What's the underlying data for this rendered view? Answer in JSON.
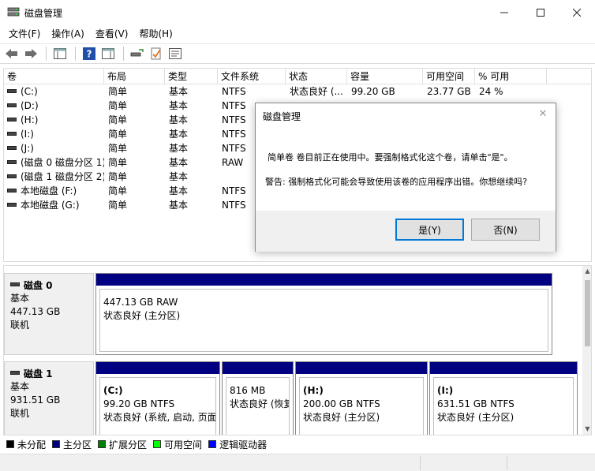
{
  "window": {
    "title": "磁盘管理",
    "minimize": "—",
    "maximize": "☐",
    "close": "✕"
  },
  "menu": [
    {
      "label": "文件(F)"
    },
    {
      "label": "操作(A)"
    },
    {
      "label": "查看(V)"
    },
    {
      "label": "帮助(H)"
    }
  ],
  "toolbar": {
    "icons": [
      "back-arrow-icon",
      "forward-arrow-icon",
      "console-tree-icon",
      "help-icon",
      "action-pane-icon",
      "connect-icon",
      "checklist-icon",
      "properties-icon"
    ]
  },
  "volume_list": {
    "columns": [
      "卷",
      "布局",
      "类型",
      "文件系统",
      "状态",
      "容量",
      "可用空间",
      "% 可用"
    ],
    "rows": [
      {
        "volume": "(C:)",
        "layout": "简单",
        "type": "基本",
        "fs": "NTFS",
        "status": "状态良好 (...",
        "capacity": "99.20 GB",
        "free": "23.77 GB",
        "pct": "24 %"
      },
      {
        "volume": "(D:)",
        "layout": "简单",
        "type": "基本",
        "fs": "NTFS",
        "status": "",
        "capacity": "",
        "free": "",
        "pct": ""
      },
      {
        "volume": "(H:)",
        "layout": "简单",
        "type": "基本",
        "fs": "NTFS",
        "status": "",
        "capacity": "",
        "free": "",
        "pct": ""
      },
      {
        "volume": "(I:)",
        "layout": "简单",
        "type": "基本",
        "fs": "NTFS",
        "status": "",
        "capacity": "",
        "free": "",
        "pct": ""
      },
      {
        "volume": "(J:)",
        "layout": "简单",
        "type": "基本",
        "fs": "NTFS",
        "status": "",
        "capacity": "",
        "free": "",
        "pct": ""
      },
      {
        "volume": "(磁盘 0 磁盘分区 1)",
        "layout": "简单",
        "type": "基本",
        "fs": "RAW",
        "status": "",
        "capacity": "",
        "free": "",
        "pct": ""
      },
      {
        "volume": "(磁盘 1 磁盘分区 2)",
        "layout": "简单",
        "type": "基本",
        "fs": "",
        "status": "",
        "capacity": "",
        "free": "",
        "pct": ""
      },
      {
        "volume": "本地磁盘 (F:)",
        "layout": "简单",
        "type": "基本",
        "fs": "NTFS",
        "status": "",
        "capacity": "",
        "free": "",
        "pct": ""
      },
      {
        "volume": "本地磁盘 (G:)",
        "layout": "简单",
        "type": "基本",
        "fs": "NTFS",
        "status": "",
        "capacity": "",
        "free": "",
        "pct": ""
      }
    ]
  },
  "disks": [
    {
      "name": "磁盘 0",
      "kind": "基本",
      "size": "447.13 GB",
      "state": "联机",
      "partitions": [
        {
          "label": "",
          "line1": "447.13 GB RAW",
          "line2": "状态良好 (主分区)"
        }
      ]
    },
    {
      "name": "磁盘 1",
      "kind": "基本",
      "size": "931.51 GB",
      "state": "联机",
      "partitions": [
        {
          "label": "(C:)",
          "line1": "99.20 GB NTFS",
          "line2": "状态良好 (系统, 启动, 页面"
        },
        {
          "label": "",
          "line1": "816 MB",
          "line2": "状态良好 (恢复"
        },
        {
          "label": "(H:)",
          "line1": "200.00 GB NTFS",
          "line2": "状态良好 (主分区)"
        },
        {
          "label": "(I:)",
          "line1": "631.51 GB NTFS",
          "line2": "状态良好 (主分区)"
        }
      ]
    }
  ],
  "scrollbar": {
    "up": "▲",
    "down": "▼"
  },
  "legend": [
    {
      "label": "未分配",
      "color": "#000000"
    },
    {
      "label": "主分区",
      "color": "#000080"
    },
    {
      "label": "扩展分区",
      "color": "#008000"
    },
    {
      "label": "可用空间",
      "color": "#00ff00"
    },
    {
      "label": "逻辑驱动器",
      "color": "#0000ff"
    }
  ],
  "dialog": {
    "title": "磁盘管理",
    "close": "✕",
    "message1": "简单卷 卷目前正在使用中。要强制格式化这个卷，请单击\"是\"。",
    "message2": "警告: 强制格式化可能会导致使用该卷的应用程序出错。你想继续吗?",
    "yes_label": "是(Y)",
    "no_label": "否(N)"
  }
}
